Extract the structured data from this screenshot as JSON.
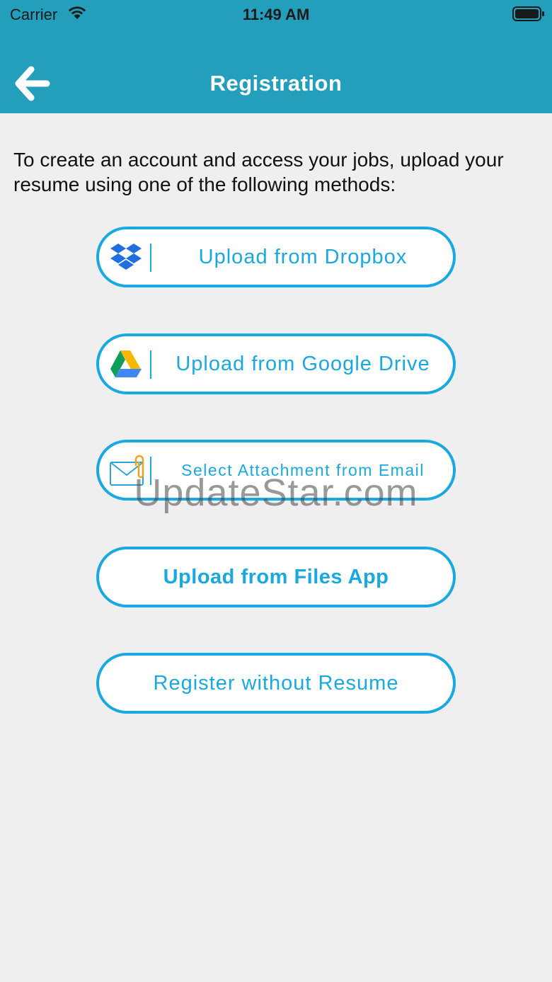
{
  "status_bar": {
    "carrier": "Carrier",
    "time": "11:49 AM",
    "wifi_icon": "wifi-icon",
    "battery_icon": "battery-icon"
  },
  "header": {
    "title": "Registration",
    "back_icon": "back-arrow-icon",
    "background_color": "#239fbb"
  },
  "intro_text": "To create an account and access your jobs, upload your resume using one of the following methods:",
  "options": [
    {
      "label": "Upload from Dropbox",
      "icon": "dropbox-icon"
    },
    {
      "label": "Upload from Google Drive",
      "icon": "google-drive-icon"
    },
    {
      "label": "Select Attachment from Email",
      "icon": "email-attachment-icon"
    },
    {
      "label": "Upload from Files App"
    },
    {
      "label": "Register without Resume"
    }
  ],
  "accent_color": "#1aa8e0",
  "watermark": "UpdateStar.com"
}
